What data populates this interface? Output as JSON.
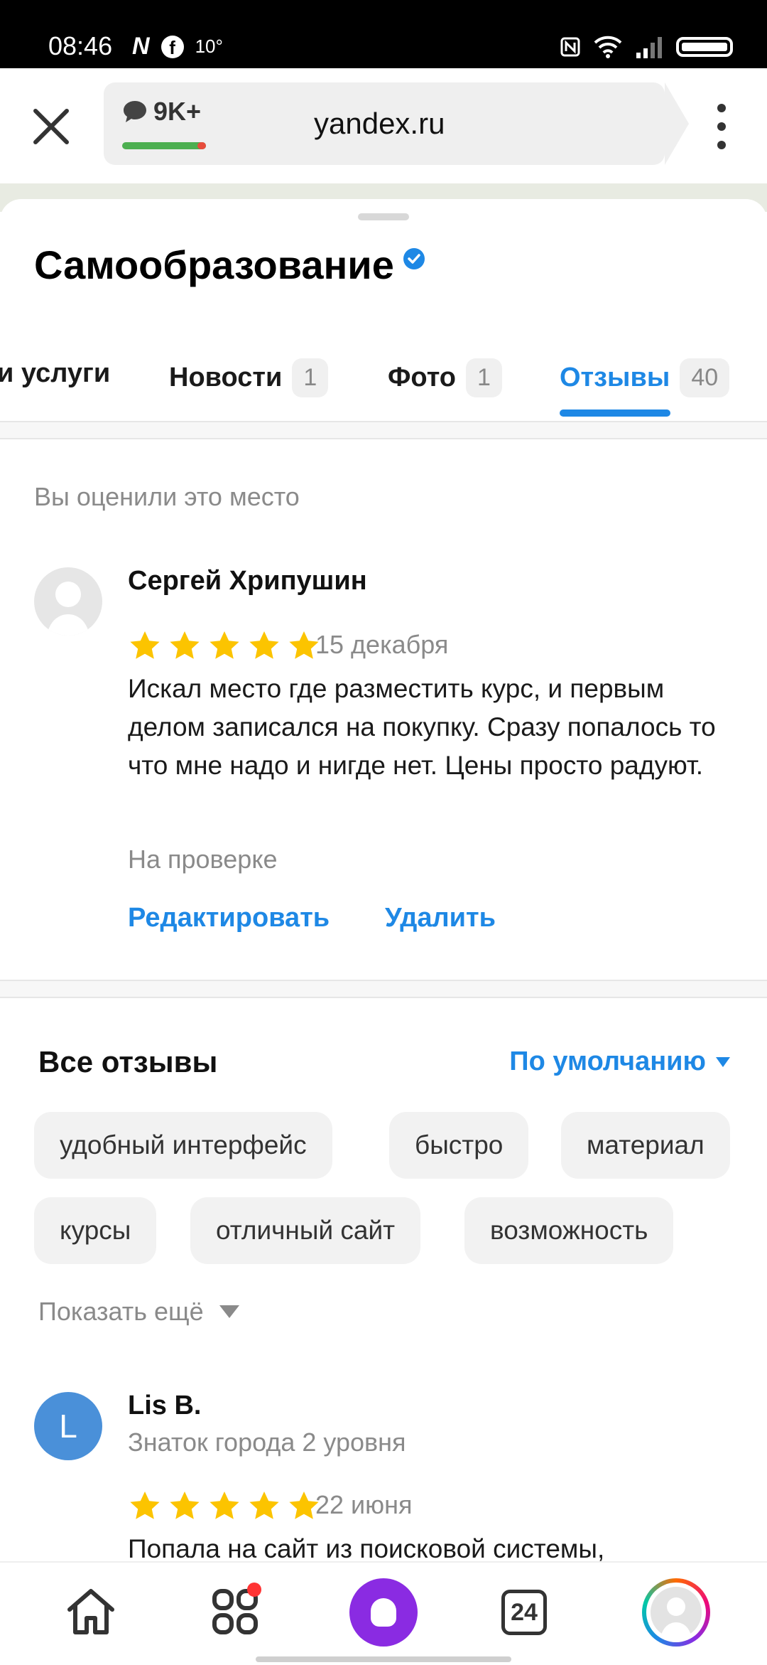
{
  "status_bar": {
    "time": "08:46",
    "temperature": "10°"
  },
  "browser": {
    "comments_count": "9K+",
    "url": "yandex.ru"
  },
  "place": {
    "title": "Самообразование"
  },
  "tabs": [
    {
      "label": "и услуги",
      "count": ""
    },
    {
      "label": "Новости",
      "count": "1"
    },
    {
      "label": "Фото",
      "count": "1"
    },
    {
      "label": "Отзывы",
      "count": "40"
    }
  ],
  "my_review": {
    "section_label": "Вы оценили это место",
    "author": "Сергей Хрипушин",
    "rating": 5,
    "date": "15 декабря",
    "text": "Искал место где разместить курс, и первым делом записался на покупку. Сразу попалось то что мне надо и нигде нет. Цены просто радуют.",
    "status": "На проверке",
    "edit_label": "Редактировать",
    "delete_label": "Удалить"
  },
  "all_reviews": {
    "title": "Все отзывы",
    "sort_label": "По умолчанию",
    "chips": [
      "удобный интерфейс",
      "быстро",
      "материал",
      "курсы",
      "отличный сайт",
      "возможность"
    ],
    "show_more": "Показать ещё"
  },
  "review_2": {
    "avatar_letter": "L",
    "author": "Lis B.",
    "author_level": "Знаток города 2 уровня",
    "rating": 5,
    "date": "22 июня",
    "text": "Попала на сайт из поисковой системы,"
  },
  "bottom_nav": {
    "tabs_count": "24"
  },
  "colors": {
    "accent": "#1e88e5",
    "star": "#fcc400",
    "alice": "#8a2be2"
  }
}
